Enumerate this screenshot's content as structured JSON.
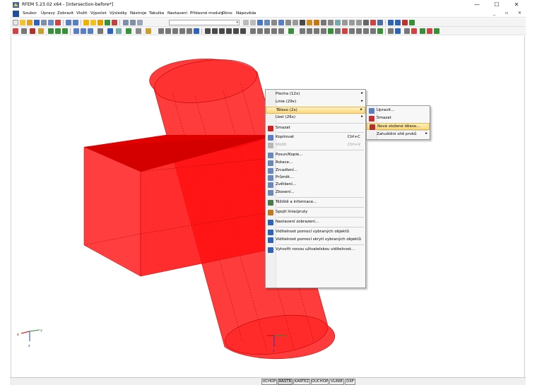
{
  "window": {
    "title": "RFEM 5.23.02 x64 - [intersection-before*]",
    "minimize_glyph": "—",
    "maximize_glyph": "☐",
    "close_glyph": "✕"
  },
  "menu": {
    "items": [
      "Soubor",
      "Úpravy",
      "Zobrazit",
      "Vložit",
      "Výpočet",
      "Výsledky",
      "Nástroje",
      "Tabulka",
      "Nastavení",
      "Přídavné moduly",
      "Okno",
      "Nápověda"
    ],
    "mdi": [
      "_",
      "▫",
      "✕"
    ]
  },
  "toolbar": {
    "combo_value": "",
    "combo_arrow": "▾"
  },
  "context_menu": {
    "items": [
      {
        "label": "Plocha (12x)",
        "arrow": "▸",
        "icon": "none"
      },
      {
        "label": "Linie (29x)",
        "arrow": "▸",
        "icon": "none"
      },
      {
        "label": "Těleso (2x)",
        "arrow": "▸",
        "icon": "none",
        "highlight": true
      },
      {
        "label": "Uzel (26x)",
        "arrow": "▸",
        "icon": "none"
      },
      {
        "label": "Smazat",
        "icon": "delete-icon"
      },
      {
        "label": "Kopírovat",
        "shortcut": "Ctrl+C",
        "icon": "copy-icon"
      },
      {
        "label": "Vložit",
        "shortcut": "Ctrl+V",
        "icon": "paste-icon",
        "disabled": true
      },
      {
        "label": "Posun/Kopie...",
        "icon": "move-copy-icon"
      },
      {
        "label": "Rotace...",
        "icon": "rotate-icon"
      },
      {
        "label": "Zrcadlení...",
        "icon": "mirror-icon"
      },
      {
        "label": "Průmět...",
        "icon": "project-icon"
      },
      {
        "label": "Zvětšení...",
        "icon": "scale-icon"
      },
      {
        "label": "Zkosení...",
        "icon": "shear-icon"
      },
      {
        "label": "Těžiště a informace...",
        "icon": "centroid-icon"
      },
      {
        "label": "Spojit linie/pruty",
        "icon": "connect-lines-icon"
      },
      {
        "label": "Nastavení zobrazení...",
        "icon": "display-settings-icon"
      },
      {
        "label": "Viditelnost pomocí vybraných objektů",
        "icon": "visibility-selected-icon"
      },
      {
        "label": "Viditelnost pomocí skrytí vybraných objektů",
        "icon": "visibility-hide-icon"
      },
      {
        "label": "Vytvořit novou uživatelskou viditelnost...",
        "icon": "new-visibility-icon"
      }
    ]
  },
  "submenu": {
    "items": [
      {
        "label": "Upravit...",
        "icon": "edit-solid-icon"
      },
      {
        "label": "Smazat",
        "icon": "delete-solid-icon"
      },
      {
        "label": "Nové složené těleso...",
        "icon": "new-compound-solid-icon",
        "highlight": true
      },
      {
        "label": "Zahuštění sítě prvků",
        "arrow": "▸",
        "icon": "none"
      }
    ]
  },
  "axes": {
    "x_label": "x",
    "y_label": "y",
    "z_label": "z"
  },
  "statusbar": {
    "buttons": [
      "UCHOP",
      "RASTR",
      "KARTEZ",
      "OUCHOP",
      "VLINIE",
      "DXF"
    ],
    "active": [
      "RASTR"
    ]
  },
  "colors": {
    "solid_red": "#ff1a1a",
    "highlight_yellow": "#fbd779"
  }
}
